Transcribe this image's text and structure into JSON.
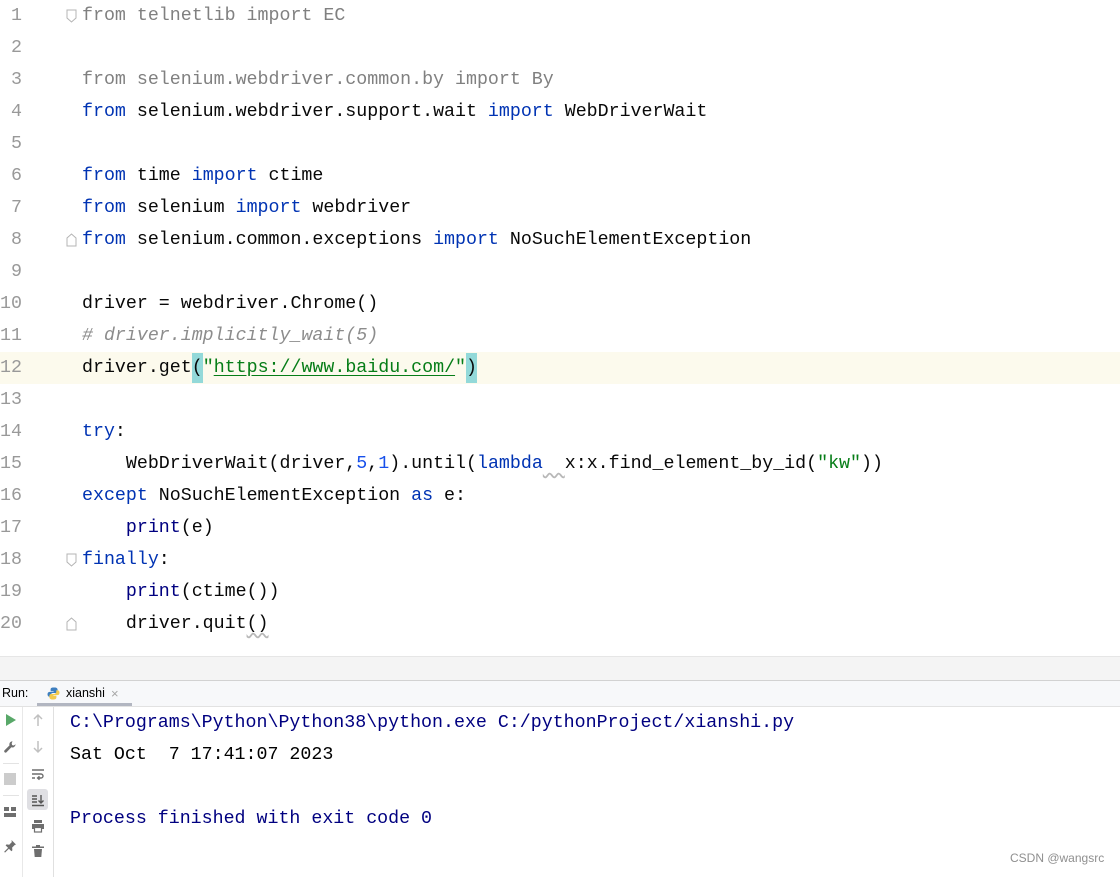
{
  "colors": {
    "plain_text": "#080808",
    "keyword": "#0033B3",
    "number": "#1750EB",
    "string": "#067D17",
    "comment": "#8C8C8C",
    "builtin": "#000080",
    "unused_import": "#808080",
    "line_number": "#999999",
    "current_line": "#FCFAED",
    "brace_match": "#93D9D9",
    "run_icon": "#59A869"
  },
  "editor": {
    "current_line": 12,
    "lines": [
      {
        "n": "1",
        "fold": "start",
        "tokens": [
          {
            "t": "from telnetlib import EC",
            "c": "#808080"
          }
        ]
      },
      {
        "n": "2",
        "tokens": []
      },
      {
        "n": "3",
        "tokens": [
          {
            "t": "from selenium.webdriver.common.by import By",
            "c": "#808080"
          }
        ]
      },
      {
        "n": "4",
        "tokens": [
          {
            "t": "from",
            "c": "#0033B3"
          },
          {
            "t": " selenium.webdriver.support.wait "
          },
          {
            "t": "import",
            "c": "#0033B3"
          },
          {
            "t": " WebDriverWait"
          }
        ]
      },
      {
        "n": "5",
        "tokens": []
      },
      {
        "n": "6",
        "tokens": [
          {
            "t": "from",
            "c": "#0033B3"
          },
          {
            "t": " time "
          },
          {
            "t": "import",
            "c": "#0033B3"
          },
          {
            "t": " ctime"
          }
        ]
      },
      {
        "n": "7",
        "tokens": [
          {
            "t": "from",
            "c": "#0033B3"
          },
          {
            "t": " selenium "
          },
          {
            "t": "import",
            "c": "#0033B3"
          },
          {
            "t": " webdriver"
          }
        ]
      },
      {
        "n": "8",
        "fold": "end",
        "tokens": [
          {
            "t": "from",
            "c": "#0033B3"
          },
          {
            "t": " selenium.common.exceptions "
          },
          {
            "t": "import",
            "c": "#0033B3"
          },
          {
            "t": " NoSuchElementException"
          }
        ]
      },
      {
        "n": "9",
        "tokens": []
      },
      {
        "n": "10",
        "tokens": [
          {
            "t": "driver = webdriver.Chrome()"
          }
        ]
      },
      {
        "n": "11",
        "tokens": [
          {
            "t": "# driver.implicitly_wait(5)",
            "c": "#8C8C8C",
            "it": true
          }
        ]
      },
      {
        "n": "12",
        "tokens": [
          {
            "t": "driver.get"
          },
          {
            "t": "(",
            "bg": "#93D9D9"
          },
          {
            "t": "\"",
            "c": "#067D17"
          },
          {
            "t": "https://www.baidu.com/",
            "c": "#067D17",
            "ul": true
          },
          {
            "t": "\"",
            "c": "#067D17"
          },
          {
            "t": ")",
            "bg": "#93D9D9"
          }
        ]
      },
      {
        "n": "13",
        "tokens": []
      },
      {
        "n": "14",
        "tokens": [
          {
            "t": "try",
            "c": "#0033B3"
          },
          {
            "t": ":"
          }
        ]
      },
      {
        "n": "15",
        "tokens": [
          {
            "t": "    WebDriverWait(driver,"
          },
          {
            "t": "5",
            "c": "#1750EB"
          },
          {
            "t": ","
          },
          {
            "t": "1",
            "c": "#1750EB"
          },
          {
            "t": ").until("
          },
          {
            "t": "lambda",
            "c": "#0033B3"
          },
          {
            "t": "  ",
            "wavy": true
          },
          {
            "t": "x:x.find_element_by_id("
          },
          {
            "t": "\"kw\"",
            "c": "#067D17"
          },
          {
            "t": "))"
          }
        ]
      },
      {
        "n": "16",
        "tokens": [
          {
            "t": "except",
            "c": "#0033B3"
          },
          {
            "t": " NoSuchElementException "
          },
          {
            "t": "as",
            "c": "#0033B3"
          },
          {
            "t": " e:"
          }
        ]
      },
      {
        "n": "17",
        "tokens": [
          {
            "t": "    "
          },
          {
            "t": "print",
            "c": "#000080"
          },
          {
            "t": "(e)"
          }
        ]
      },
      {
        "n": "18",
        "fold": "start",
        "tokens": [
          {
            "t": "finally",
            "c": "#0033B3"
          },
          {
            "t": ":"
          }
        ]
      },
      {
        "n": "19",
        "tokens": [
          {
            "t": "    "
          },
          {
            "t": "print",
            "c": "#000080"
          },
          {
            "t": "(ctime())"
          }
        ]
      },
      {
        "n": "20",
        "fold": "end",
        "tokens": [
          {
            "t": "    driver.quit"
          },
          {
            "t": "()",
            "wavy": true
          }
        ]
      }
    ]
  },
  "run": {
    "label": "Run:",
    "tab": {
      "icon": "python-file-icon",
      "name": "xianshi",
      "close": "×"
    },
    "toolbar_left": [
      "run-icon",
      "wrench-icon",
      "stop-icon",
      "layout-icon",
      "pin-icon"
    ],
    "toolbar_right": [
      "up-arrow-icon",
      "down-arrow-icon",
      "soft-wrap-icon",
      "scroll-to-end-icon",
      "print-icon",
      "trash-icon"
    ],
    "console": [
      {
        "text": "C:\\Programs\\Python\\Python38\\python.exe C:/pythonProject/xianshi.py",
        "c": "#000080"
      },
      {
        "text": "Sat Oct  7 17:41:07 2023",
        "c": "#000000"
      },
      {
        "text": "",
        "c": "#000000"
      },
      {
        "text": "Process finished with exit code 0",
        "c": "#000080"
      }
    ]
  },
  "watermark": "CSDN @wangsrc"
}
